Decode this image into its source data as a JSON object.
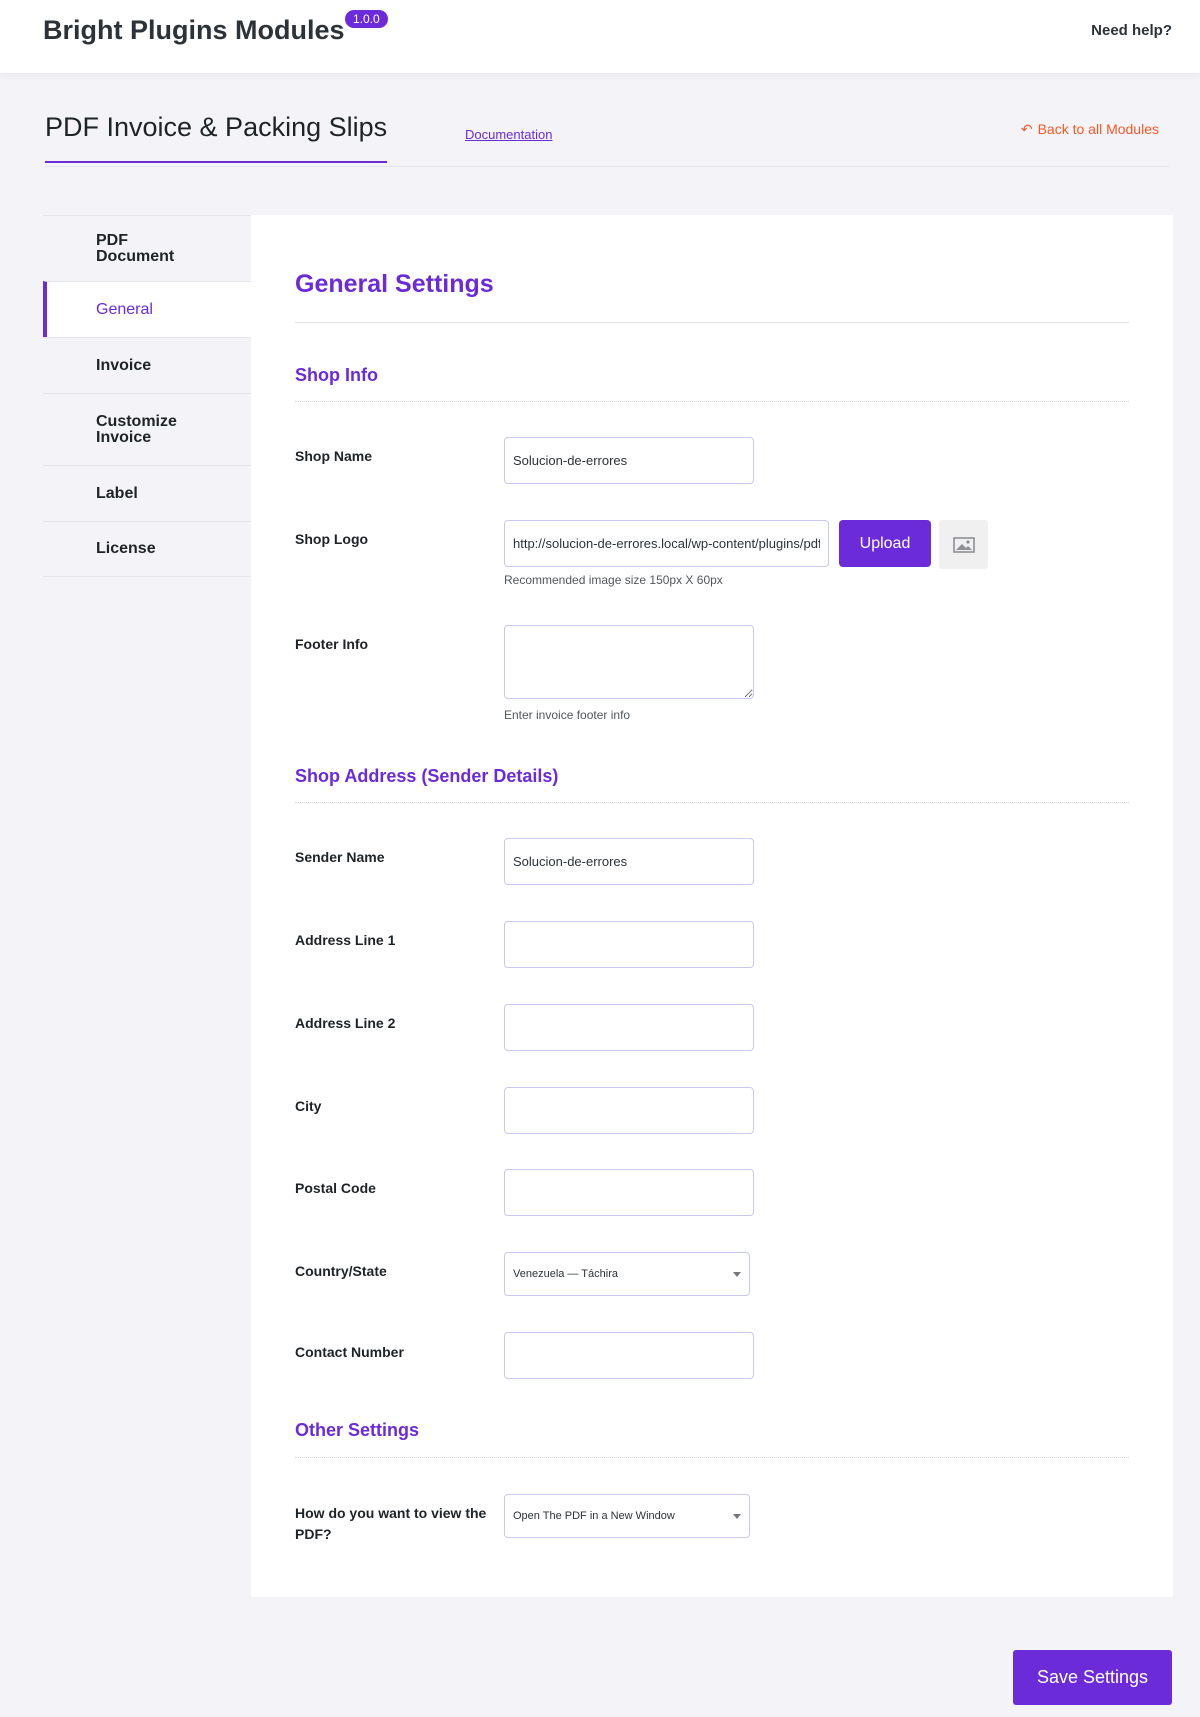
{
  "header": {
    "brand": "Bright Plugins Modules",
    "version": "1.0.0",
    "help": "Need help?"
  },
  "page": {
    "title": "PDF Invoice & Packing Slips",
    "documentation": "Documentation",
    "back": "Back to all Modules"
  },
  "sidebar": {
    "items": [
      {
        "label": "PDF Document"
      },
      {
        "label": "General"
      },
      {
        "label": "Invoice"
      },
      {
        "label": "Customize Invoice"
      },
      {
        "label": "Label"
      },
      {
        "label": "License"
      }
    ]
  },
  "settings": {
    "title": "General Settings",
    "shop_info": {
      "title": "Shop Info",
      "shop_name_label": "Shop Name",
      "shop_name_value": "Solucion-de-errores",
      "shop_logo_label": "Shop Logo",
      "shop_logo_value": "http://solucion-de-errores.local/wp-content/plugins/pdf-",
      "upload_label": "Upload",
      "logo_hint": "Recommended image size 150px X 60px",
      "footer_label": "Footer Info",
      "footer_value": "",
      "footer_hint": "Enter invoice footer info"
    },
    "shop_address": {
      "title": "Shop Address (Sender Details)",
      "sender_name_label": "Sender Name",
      "sender_name_value": "Solucion-de-errores",
      "address1_label": "Address Line 1",
      "address1_value": "",
      "address2_label": "Address Line 2",
      "address2_value": "",
      "city_label": "City",
      "city_value": "",
      "postal_label": "Postal Code",
      "postal_value": "",
      "country_label": "Country/State",
      "country_value": "Venezuela — Táchira",
      "contact_label": "Contact Number",
      "contact_value": ""
    },
    "other": {
      "title": "Other Settings",
      "view_label": "How do you want to view the PDF?",
      "view_value": "Open The PDF in a New Window"
    }
  },
  "save_label": "Save Settings",
  "colors": {
    "accent": "#6c2bd9",
    "back_link": "#f05a28"
  }
}
